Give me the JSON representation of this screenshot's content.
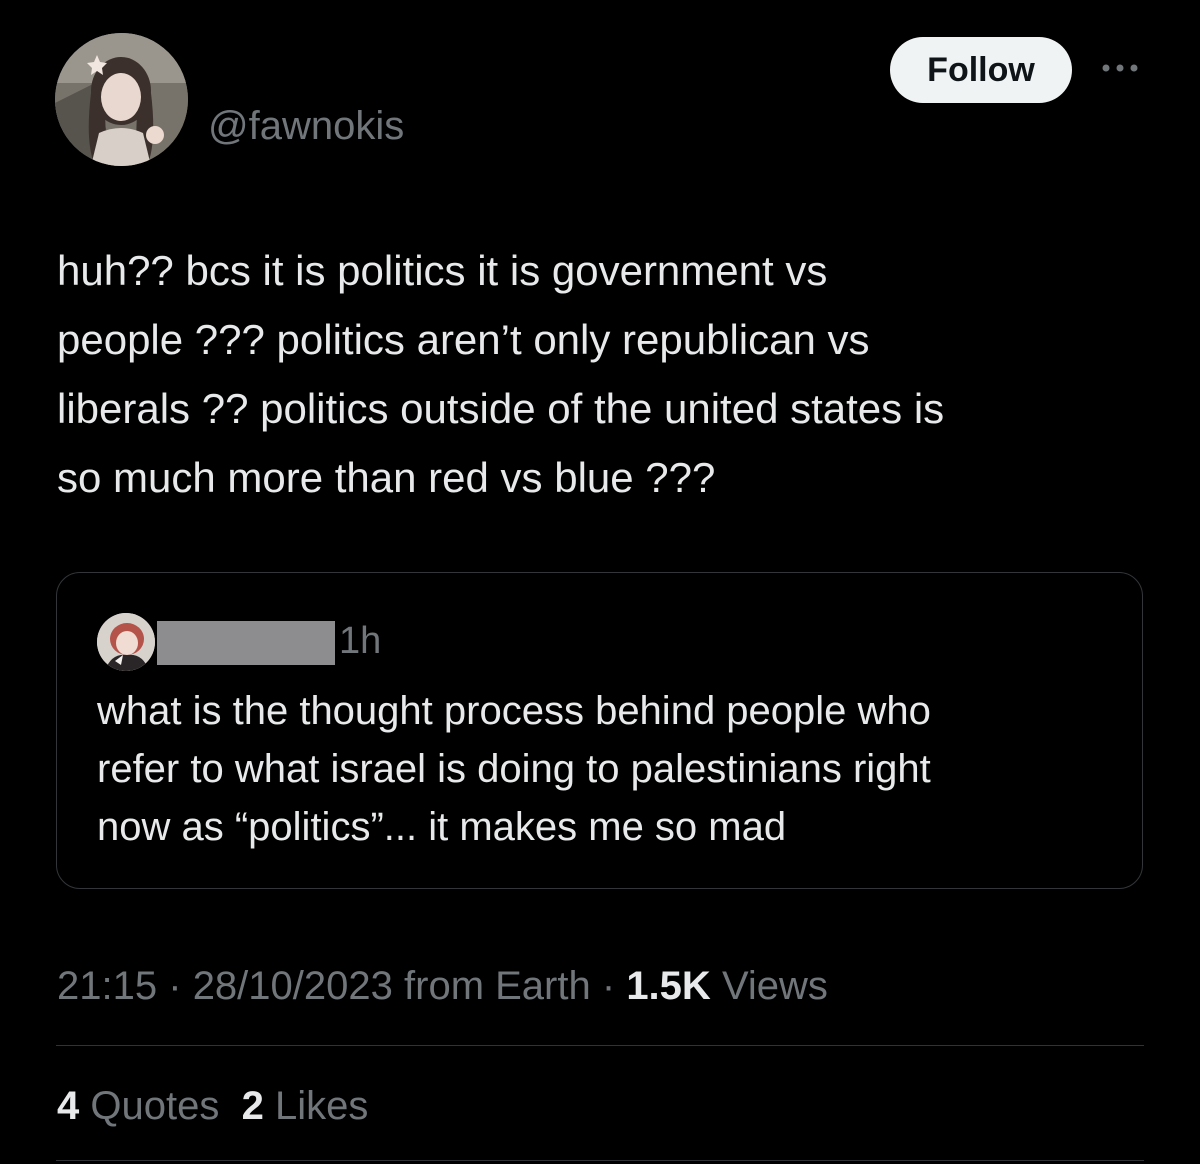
{
  "author": {
    "handle": "@fawnokis"
  },
  "actions": {
    "follow_label": "Follow"
  },
  "tweet": {
    "text": "huh?? bcs it is politics it is government vs\npeople ??? politics aren’t only republican vs\nliberals ?? politics outside of the united states is\nso much more than red vs blue ???"
  },
  "quoted_tweet": {
    "time": "1h",
    "text": "what is the thought process behind people who\nrefer to what israel is doing to palestinians right\nnow as “politics”... it makes me so mad"
  },
  "meta": {
    "time": "21:15",
    "separator": "·",
    "date": "28/10/2023",
    "source": "from Earth",
    "views_count": "1.5K",
    "views_label": "Views"
  },
  "stats": {
    "quotes_count": "4",
    "quotes_label": "Quotes",
    "likes_count": "2",
    "likes_label": "Likes"
  },
  "colors": {
    "background": "#000000",
    "text_primary": "#e7e9ea",
    "text_secondary": "#71767b",
    "border": "#2f3336",
    "follow_button_bg": "#eff3f4"
  }
}
